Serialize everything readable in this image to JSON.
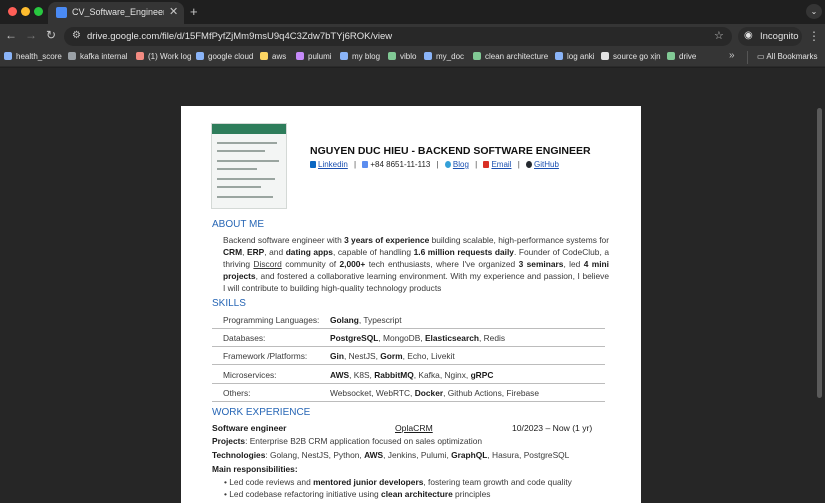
{
  "browser": {
    "tab": {
      "title": "CV_Software_Engineer_Golan"
    },
    "url": "drive.google.com/file/d/15FMfPyfZjMm9msU9q4C3Zdw7bTYj6ROK/view",
    "profile_label": "Incognito",
    "bookmarks": [
      {
        "label": "health_score",
        "color": "#8ab4f8"
      },
      {
        "label": "kafka internal",
        "color": "#9aa0a6"
      },
      {
        "label": "(1) Work log",
        "color": "#f28b82"
      },
      {
        "label": "google cloud",
        "color": "#8ab4f8"
      },
      {
        "label": "aws",
        "color": "#fdd663"
      },
      {
        "label": "pulumi",
        "color": "#c58af9"
      },
      {
        "label": "my blog",
        "color": "#8ab4f8"
      },
      {
        "label": "viblo",
        "color": "#81c995"
      },
      {
        "label": "my_doc",
        "color": "#8ab4f8"
      },
      {
        "label": "clean architecture",
        "color": "#81c995"
      },
      {
        "label": "log anki",
        "color": "#8ab4f8"
      },
      {
        "label": "source go xịn",
        "color": "#e3e3e3"
      },
      {
        "label": "drive",
        "color": "#81c995"
      }
    ],
    "all_bookmarks": "All Bookmarks"
  },
  "cv": {
    "name": "NGUYEN DUC HIEU - BACKEND SOFTWARE ENGINEER",
    "contacts": {
      "linkedin": "Linkedin",
      "phone": "+84 8651-11-113",
      "blog": "Blog",
      "email": "Email",
      "github": "GitHub",
      "separator": "|"
    },
    "about": {
      "heading": "ABOUT ME",
      "p1": "Backend software engineer with ",
      "p1b": "3 years of experience",
      "p2": " building scalable, high-performance systems for ",
      "p2b": "CRM",
      "p3": ", ",
      "p3b": "ERP",
      "p4": ", and ",
      "p4b": "dating apps",
      "p5": ", capable of handling ",
      "p5b": "1.6 million requests daily",
      "p6": ". Founder of CodeClub, a thriving ",
      "p6u": "Discord",
      "p7": " community of ",
      "p7b": "2,000+",
      "p8": " tech enthusiasts, where I've organized ",
      "p8b": "3 seminars",
      "p9": ", led ",
      "p9b": "4 mini projects",
      "p10": ", and fostered a collaborative learning environment. With my experience and passion, I believe I will contribute to building high-quality technology products"
    },
    "skills": {
      "heading": "SKILLS",
      "rows": [
        {
          "label": "Programming Languages:",
          "parts": [
            {
              "t": "Golang",
              "b": true
            },
            {
              "t": ", Typescript"
            }
          ]
        },
        {
          "label": "Databases:",
          "parts": [
            {
              "t": "PostgreSQL",
              "b": true
            },
            {
              "t": ", MongoDB, "
            },
            {
              "t": "Elasticsearch",
              "b": true
            },
            {
              "t": ", Redis"
            }
          ]
        },
        {
          "label": "Framework /Platforms:",
          "parts": [
            {
              "t": "Gin",
              "b": true
            },
            {
              "t": ", NestJS, "
            },
            {
              "t": "Gorm",
              "b": true
            },
            {
              "t": ", Echo, Livekit"
            }
          ]
        },
        {
          "label": "Microservices:",
          "parts": [
            {
              "t": "AWS",
              "b": true
            },
            {
              "t": ", K8S, "
            },
            {
              "t": "RabbitMQ",
              "b": true
            },
            {
              "t": ", Kafka, Nginx, "
            },
            {
              "t": "gRPC",
              "b": true
            }
          ]
        },
        {
          "label": "Others:",
          "parts": [
            {
              "t": "Websocket, WebRTC, "
            },
            {
              "t": "Docker",
              "b": true
            },
            {
              "t": ", Github Actions, Firebase"
            }
          ]
        }
      ]
    },
    "work": {
      "heading": "WORK EXPERIENCE",
      "title": "Software engineer",
      "company": "OplaCRM",
      "period": "10/2023 – Now (1 yr)",
      "projects_label": "Projects",
      "projects_value": ":  Enterprise B2B CRM application focused on sales optimization",
      "tech_label": "Technologies",
      "tech_parts": [
        {
          "t": ": Golang, NestJS, Python, "
        },
        {
          "t": "AWS",
          "b": true
        },
        {
          "t": ", Jenkins, Pulumi, "
        },
        {
          "t": "GraphQL",
          "b": true
        },
        {
          "t": ", Hasura, PostgreSQL"
        }
      ],
      "resp_label": "Main responsibilities:",
      "bullets": [
        [
          {
            "t": "• Led code reviews and "
          },
          {
            "t": "mentored junior developers",
            "b": true
          },
          {
            "t": ", fostering team growth and code quality"
          }
        ],
        [
          {
            "t": "• Led codebase refactoring initiative using "
          },
          {
            "t": "clean architecture",
            "b": true
          },
          {
            "t": " principles"
          }
        ]
      ]
    }
  }
}
